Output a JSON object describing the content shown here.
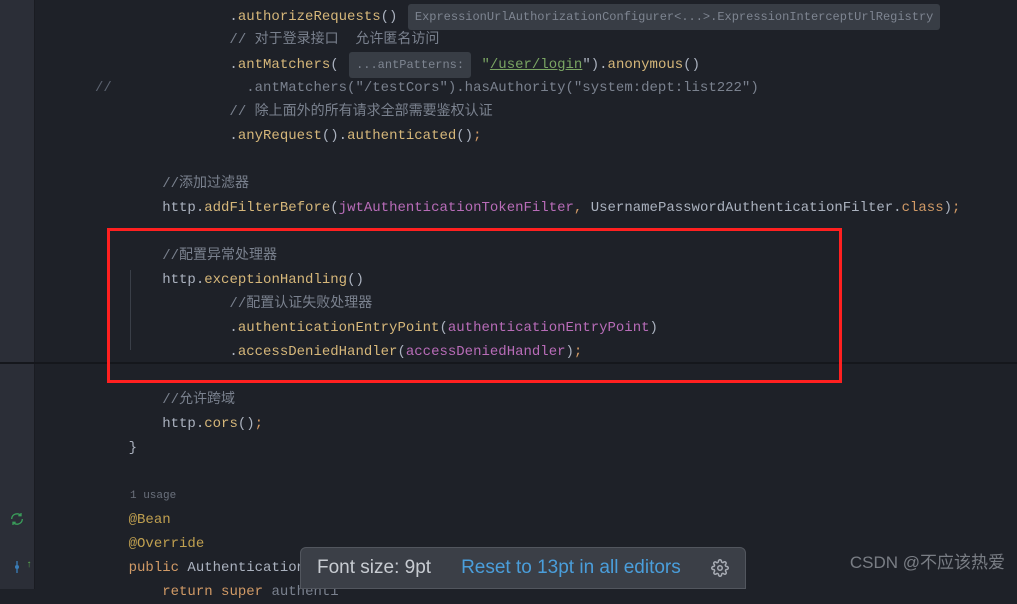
{
  "code": {
    "l1a": ".",
    "l1b": "authorizeRequests",
    "l1c": "()",
    "hint1": "ExpressionUrlAuthorizationConfigurer<...>.ExpressionInterceptUrlRegistry",
    "l2": "// 对于登录接口  允许匿名访问",
    "l3a": ".",
    "l3b": "antMatchers",
    "l3c": "(",
    "hint2": "...antPatterns:",
    "l3d": " \"",
    "l3e": "/user/login",
    "l3f": "\").",
    "l3g": "anonymous",
    "l3h": "()",
    "bars": "//",
    "l4a": ".antMatchers(",
    "l4b": "\"/testCors\"",
    "l4c": ").hasAuthority(",
    "l4d": "\"system:dept:list222\"",
    "l4e": ")",
    "l5": "// 除上面外的所有请求全部需要鉴权认证",
    "l6a": ".",
    "l6b": "anyRequest",
    "l6c": "().",
    "l6d": "authenticated",
    "l6e": "()",
    "l6f": ";",
    "l7": "//添加过滤器",
    "l8a": "http.",
    "l8b": "addFilterBefore",
    "l8c": "(",
    "l8d": "jwtAuthenticationTokenFilter",
    "l8e": ",",
    "l8f": " UsernamePasswordAuthenticationFilter.",
    "l8g": "class",
    "l8h": ")",
    "l8i": ";",
    "l9": "//配置异常处理器",
    "l10a": "http.",
    "l10b": "exceptionHandling",
    "l10c": "()",
    "l11": "//配置认证失败处理器",
    "l12a": ".",
    "l12b": "authenticationEntryPoint",
    "l12c": "(",
    "l12d": "authenticationEntryPoint",
    "l12e": ")",
    "l13a": ".",
    "l13b": "accessDeniedHandler",
    "l13c": "(",
    "l13d": "accessDeniedHandler",
    "l13e": ")",
    "l13f": ";",
    "l14": "//允许跨域",
    "l15a": "http.",
    "l15b": "cors",
    "l15c": "()",
    "l15d": ";",
    "l16": "}",
    "usage": "1 usage",
    "l17": "@Bean",
    "l18": "@Override",
    "l19a": "public",
    "l19b": " AuthenticationMana",
    "l20a": "return",
    "l20b": " ",
    "l20c": "super",
    "l20d": " authenti"
  },
  "popup": {
    "label": "Font size: 9pt",
    "reset": "Reset to 13pt in all editors"
  },
  "watermark": "CSDN @不应该热爱"
}
